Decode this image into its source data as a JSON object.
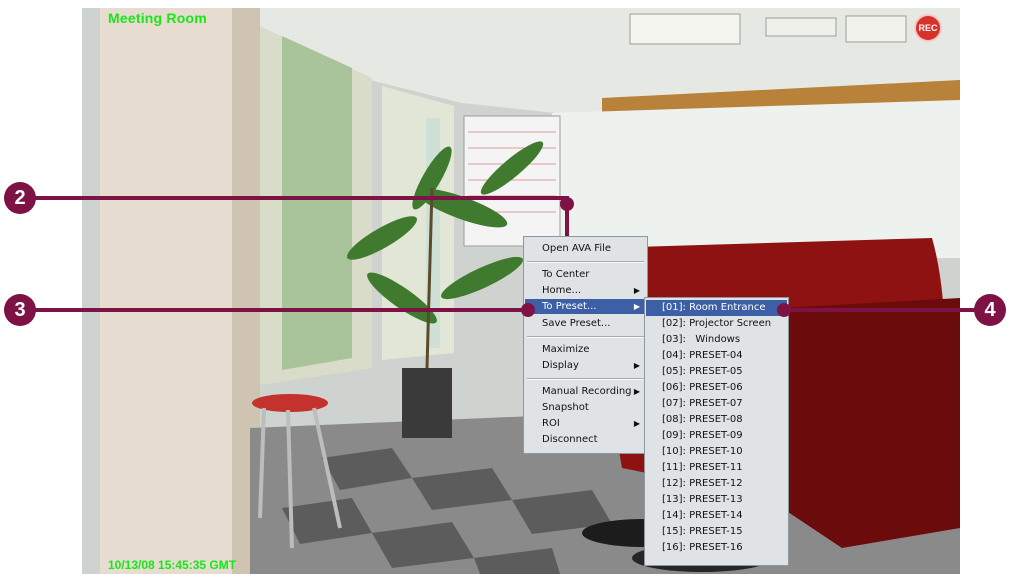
{
  "camera": {
    "title": "Meeting Room",
    "timestamp": "10/13/08 15:45:35 GMT",
    "rec_label": "REC"
  },
  "context_menu": {
    "items": [
      {
        "label": "Open AVA File",
        "has_submenu": false
      },
      {
        "label": "To Center",
        "has_submenu": false
      },
      {
        "label": "Home...",
        "has_submenu": true
      },
      {
        "label": "To Preset...",
        "has_submenu": true,
        "highlighted": true
      },
      {
        "label": "Save Preset...",
        "has_submenu": false
      },
      {
        "label": "Maximize",
        "has_submenu": false
      },
      {
        "label": "Display",
        "has_submenu": true
      },
      {
        "label": "Manual Recording",
        "has_submenu": true
      },
      {
        "label": "Snapshot",
        "has_submenu": false
      },
      {
        "label": "ROI",
        "has_submenu": true
      },
      {
        "label": "Disconnect",
        "has_submenu": false
      }
    ],
    "arrow_glyph": "▶"
  },
  "preset_submenu": {
    "items": [
      "[01]: Room Entrance",
      "[02]: Projector Screen",
      "[03]:   Windows",
      "[04]: PRESET-04",
      "[05]: PRESET-05",
      "[06]: PRESET-06",
      "[07]: PRESET-07",
      "[08]: PRESET-08",
      "[09]: PRESET-09",
      "[10]: PRESET-10",
      "[11]: PRESET-11",
      "[12]: PRESET-12",
      "[13]: PRESET-13",
      "[14]: PRESET-14",
      "[15]: PRESET-15",
      "[16]: PRESET-16"
    ],
    "highlighted_index": 0
  },
  "callouts": {
    "c2": "2",
    "c3": "3",
    "c4": "4"
  },
  "colors": {
    "callout": "#7e1245",
    "menu_highlight": "#3d5fa6",
    "overlay_text": "#19e619"
  }
}
